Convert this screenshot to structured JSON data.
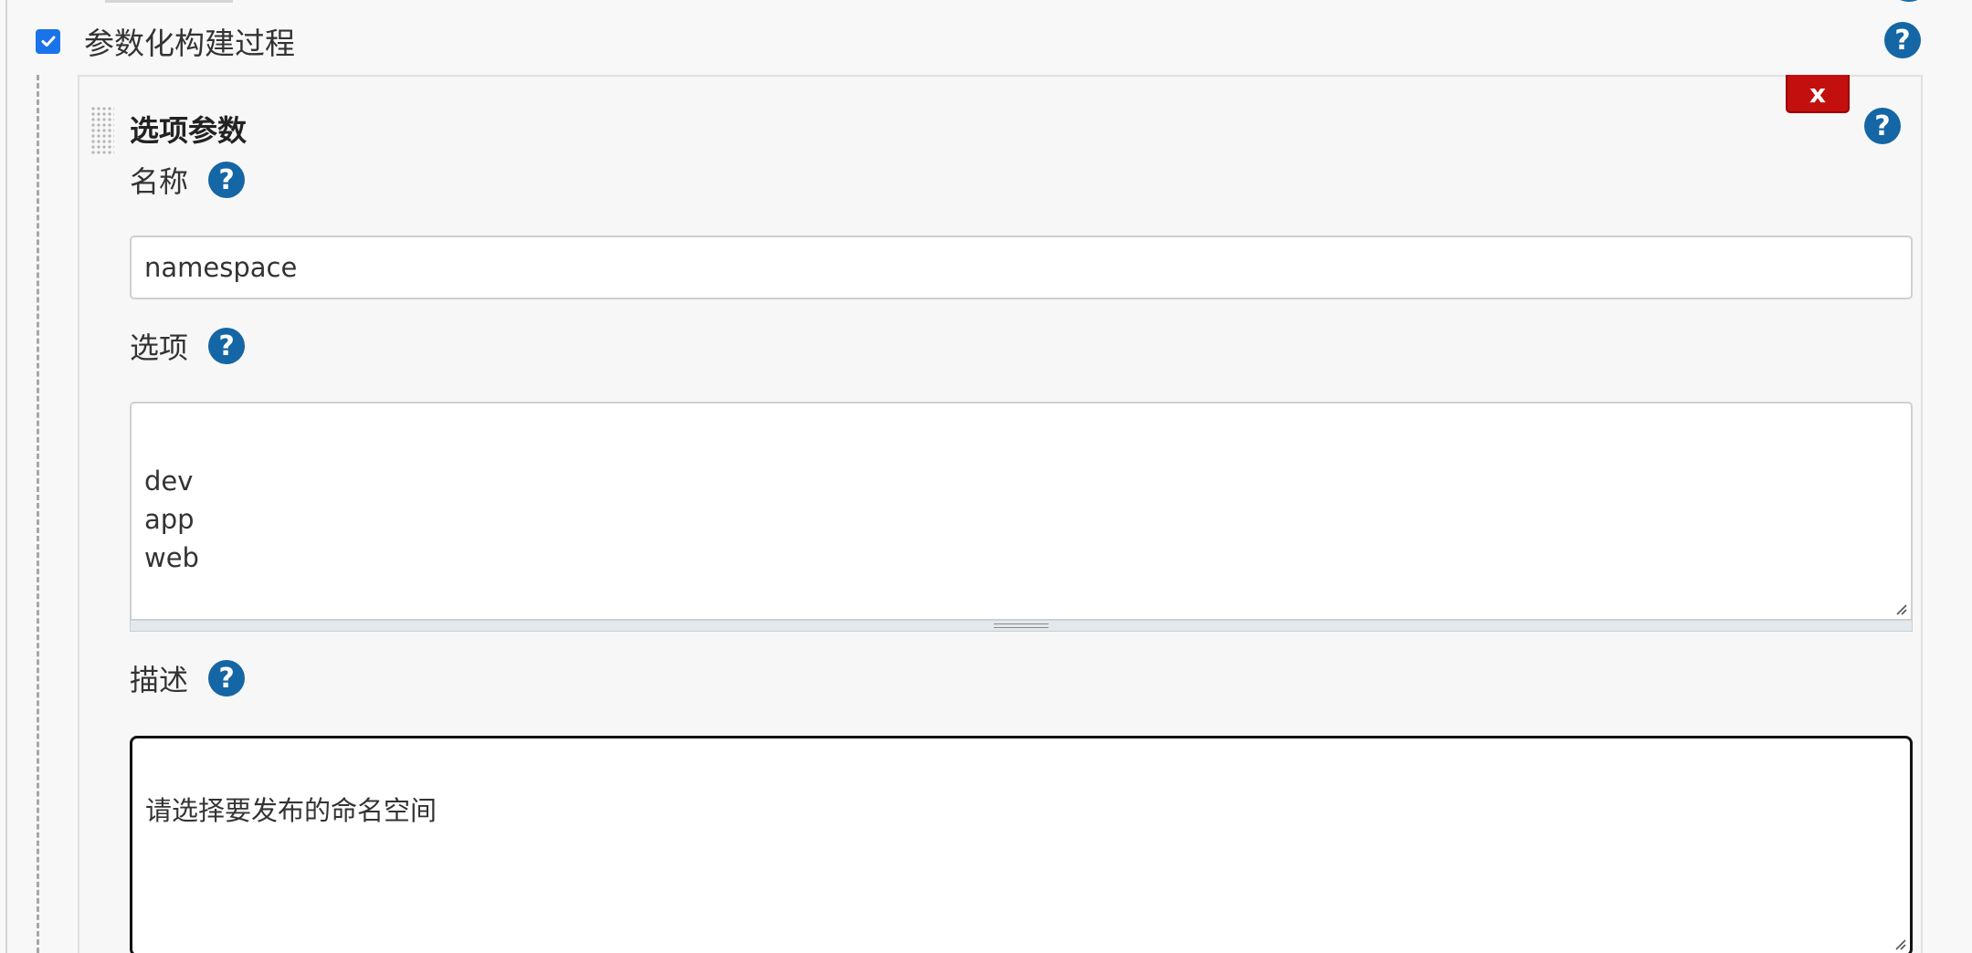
{
  "parameterized_build": {
    "label": "参数化构建过程",
    "checked": true,
    "help_icon": "help-circle-icon"
  },
  "choice_parameter": {
    "title": "选项参数",
    "delete_label": "x",
    "colors": {
      "delete_button": "#c40f0f",
      "help_icon": "#1466a5",
      "checkbox": "#1a73e8"
    },
    "name_field": {
      "label": "名称",
      "value": "namespace"
    },
    "options_field": {
      "label": "选项",
      "value": "dev\napp\nweb"
    },
    "description_field": {
      "label": "描述",
      "value": "请选择要发布的命名空间"
    }
  }
}
